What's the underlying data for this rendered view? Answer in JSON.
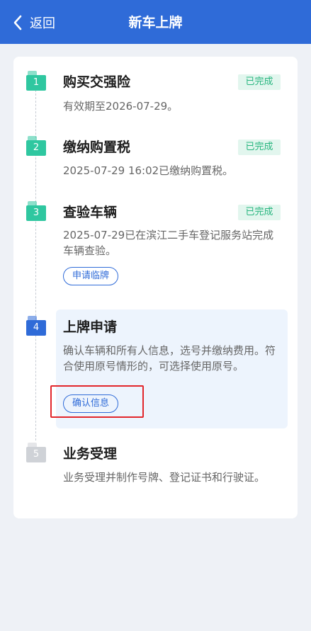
{
  "header": {
    "back_label": "返回",
    "title": "新车上牌"
  },
  "colors": {
    "primary": "#2f6bd8",
    "done": "#2fc7a0",
    "done_tag_bg": "#e2f6ee",
    "pending": "#cfd2d7",
    "highlight": "#e2262b"
  },
  "steps": [
    {
      "number": "1",
      "title": "购买交强险",
      "status": "已完成",
      "desc": "有效期至2026-07-29。"
    },
    {
      "number": "2",
      "title": "缴纳购置税",
      "status": "已完成",
      "desc": "2025-07-29 16:02已缴纳购置税。"
    },
    {
      "number": "3",
      "title": "查验车辆",
      "status": "已完成",
      "desc": "2025-07-29已在滨江二手车登记服务站完成车辆查验。",
      "button": "申请临牌"
    },
    {
      "number": "4",
      "title": "上牌申请",
      "desc": "确认车辆和所有人信息，选号并缴纳费用。符合使用原号情形的，可选择使用原号。",
      "button": "确认信息"
    },
    {
      "number": "5",
      "title": "业务受理",
      "desc": "业务受理并制作号牌、登记证书和行驶证。"
    }
  ]
}
